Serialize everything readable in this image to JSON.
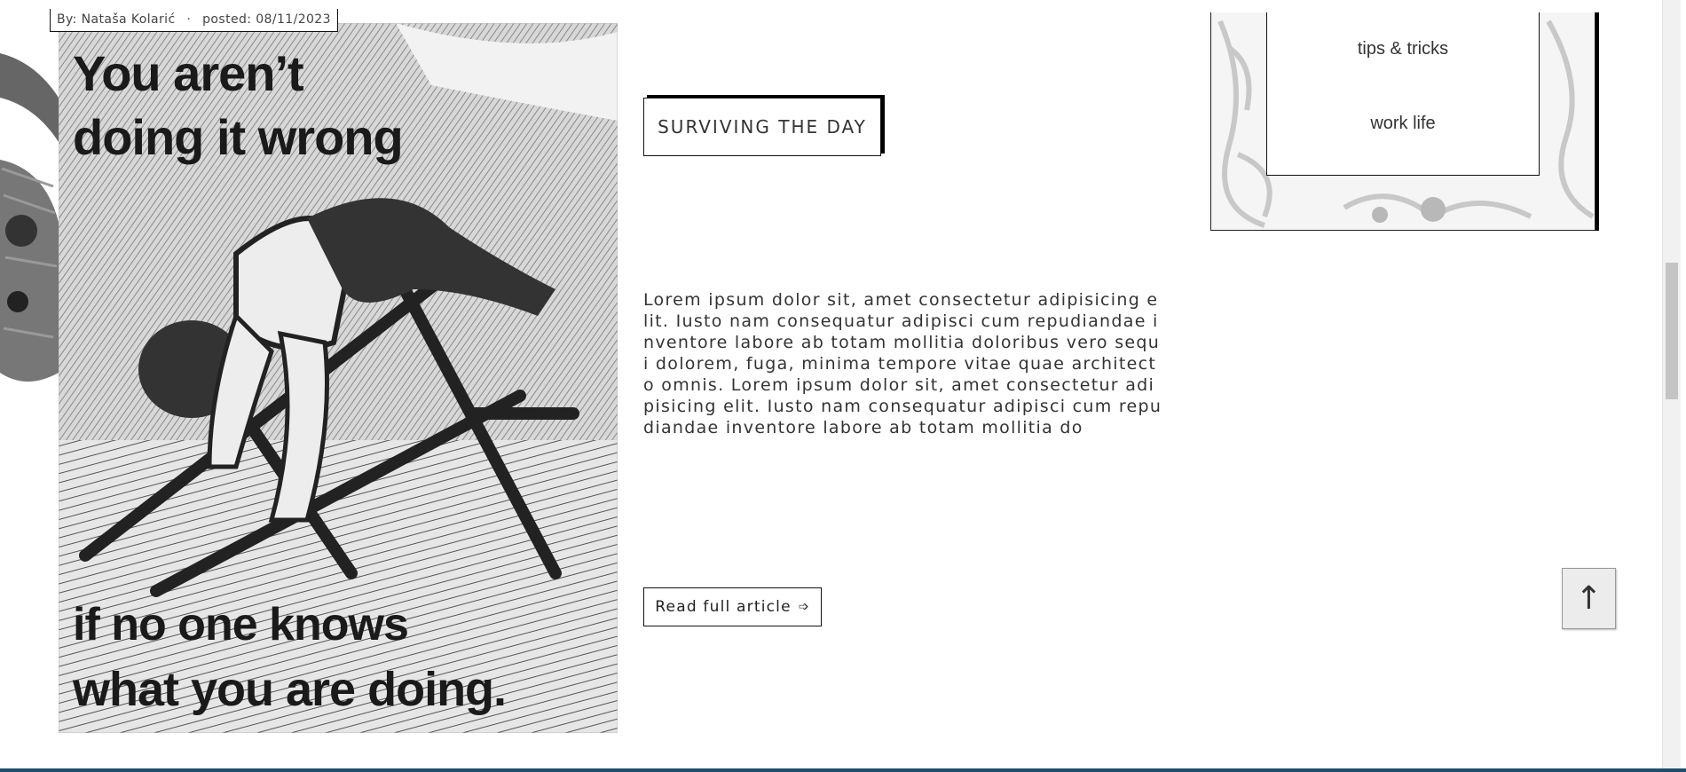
{
  "article": {
    "byline": {
      "author": "By: Nataša Kolarić",
      "separator": "·",
      "posted": "posted: 08/11/2023"
    },
    "image": {
      "line1": "You aren’t",
      "line2": "doing it wrong",
      "line3": "if no one knows",
      "line4": "what you are doing."
    },
    "category": "SURVIVING THE DAY",
    "excerpt": "Lorem ipsum dolor sit, amet consectetur adipisicing elit. Iusto nam consequatur adipisci cum repudiandae inventore labore ab totam mollitia doloribus vero sequi dolorem, fuga, minima tempore vitae quae architecto omnis. Lorem ipsum dolor sit, amet consectetur adipisicing elit. Iusto nam consequatur adipisci cum repudiandae inventore labore ab totam mollitia do",
    "read_more": {
      "label": "Read full article",
      "icon": "➩"
    }
  },
  "sidebar": {
    "tags": [
      "tips & tricks",
      "work life"
    ]
  },
  "back_to_top": {
    "icon": "↑"
  }
}
